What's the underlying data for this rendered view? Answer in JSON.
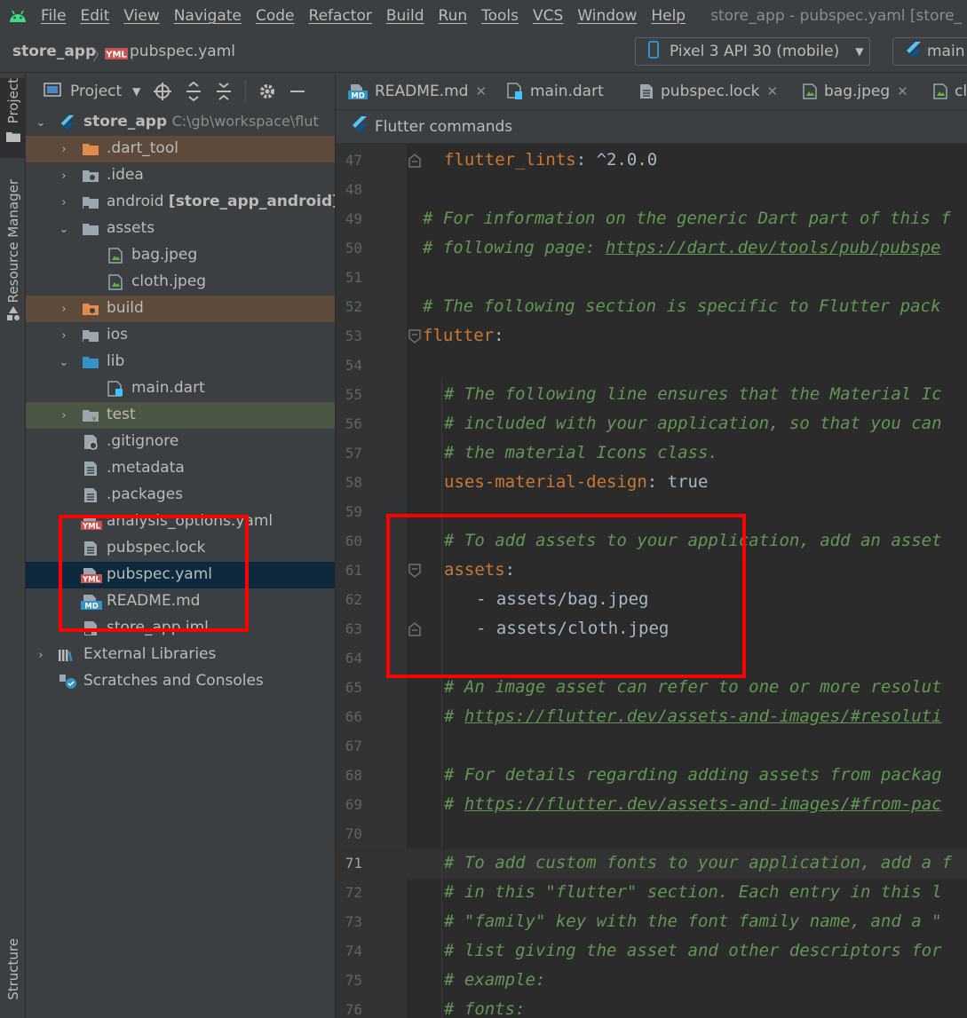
{
  "menubar": {
    "items": [
      "File",
      "Edit",
      "View",
      "Navigate",
      "Code",
      "Refactor",
      "Build",
      "Run",
      "Tools",
      "VCS",
      "Window",
      "Help"
    ],
    "window_title": "store_app - pubspec.yaml [store_"
  },
  "toolbar": {
    "project": "store_app",
    "file": "pubspec.yaml",
    "file_badge": "YML",
    "device": "Pixel 3 API 30 (mobile)",
    "run_config": "main"
  },
  "left_strip": {
    "project_tab": "Project",
    "resource_manager_tab": "Resource Manager",
    "structure_tab": "Structure"
  },
  "project_panel": {
    "title": "Project",
    "tree": [
      {
        "label": "store_app",
        "extra": "C:\\gb\\workspace\\flut",
        "expanded": true
      },
      {
        "label": ".dart_tool",
        "expanded": false
      },
      {
        "label": ".idea",
        "expanded": false
      },
      {
        "label": "android",
        "extra": "[store_app_android]",
        "expanded": false
      },
      {
        "label": "assets",
        "expanded": true
      },
      {
        "label": "bag.jpeg"
      },
      {
        "label": "cloth.jpeg"
      },
      {
        "label": "build",
        "expanded": false
      },
      {
        "label": "ios",
        "expanded": false
      },
      {
        "label": "lib",
        "expanded": true
      },
      {
        "label": "main.dart"
      },
      {
        "label": "test",
        "expanded": false
      },
      {
        "label": ".gitignore"
      },
      {
        "label": ".metadata"
      },
      {
        "label": ".packages"
      },
      {
        "label": "analysis_options.yaml"
      },
      {
        "label": "pubspec.lock"
      },
      {
        "label": "pubspec.yaml",
        "selected": true
      },
      {
        "label": "README.md"
      },
      {
        "label": "store_app.iml"
      },
      {
        "label": "External Libraries",
        "expanded": false
      },
      {
        "label": "Scratches and Consoles"
      }
    ]
  },
  "editor": {
    "tabs": [
      {
        "label": "README.md",
        "badge": "MD"
      },
      {
        "label": "main.dart"
      },
      {
        "label": "pubspec.lock"
      },
      {
        "label": "bag.jpeg"
      },
      {
        "label": "cl"
      }
    ],
    "flutter_commands": "Flutter commands",
    "lines": [
      {
        "n": "47",
        "text": "flutter_lints: ^2.0.0"
      },
      {
        "n": "48",
        "text": ""
      },
      {
        "n": "49",
        "text": "# For information on the generic Dart part of this f"
      },
      {
        "n": "50",
        "text": "# following page: ",
        "url": "https://dart.dev/tools/pub/pubspe"
      },
      {
        "n": "51",
        "text": ""
      },
      {
        "n": "52",
        "text": "# The following section is specific to Flutter pack"
      },
      {
        "n": "53",
        "text": "flutter:"
      },
      {
        "n": "54",
        "text": ""
      },
      {
        "n": "55",
        "text": "# The following line ensures that the Material Ic"
      },
      {
        "n": "56",
        "text": "# included with your application, so that you can"
      },
      {
        "n": "57",
        "text": "# the material Icons class."
      },
      {
        "n": "58",
        "text": "uses-material-design: true"
      },
      {
        "n": "59",
        "text": ""
      },
      {
        "n": "60",
        "text": "# To add assets to your application, add an asset"
      },
      {
        "n": "61",
        "text": "assets:"
      },
      {
        "n": "62",
        "text": "- assets/bag.jpeg"
      },
      {
        "n": "63",
        "text": "- assets/cloth.jpeg"
      },
      {
        "n": "64",
        "text": ""
      },
      {
        "n": "65",
        "text": "# An image asset can refer to one or more resolut"
      },
      {
        "n": "66",
        "text": "# ",
        "url": "https://flutter.dev/assets-and-images/#resoluti"
      },
      {
        "n": "67",
        "text": ""
      },
      {
        "n": "68",
        "text": "# For details regarding adding assets from packag"
      },
      {
        "n": "69",
        "text": "# ",
        "url": "https://flutter.dev/assets-and-images/#from-pac"
      },
      {
        "n": "70",
        "text": ""
      },
      {
        "n": "71",
        "text": "# To add custom fonts to your application, add a f",
        "active": true
      },
      {
        "n": "72",
        "text": "# in this \"flutter\" section. Each entry in this l"
      },
      {
        "n": "73",
        "text": "# \"family\" key with the font family name, and a \""
      },
      {
        "n": "74",
        "text": "# list giving the asset and other descriptors for"
      },
      {
        "n": "75",
        "text": "# example:"
      },
      {
        "n": "76",
        "text": "# fonts:"
      }
    ],
    "line_parts": {
      "flutter_lints_key": "flutter_lints",
      "flutter_lints_val": ": ^2.0.0",
      "flutter_key": "flutter",
      "uses_key": "uses-material-design",
      "uses_val": ": true",
      "assets_key": "assets",
      "colon": ":"
    }
  },
  "colors": {
    "highlight": "#ff0000",
    "comment": "#629755",
    "key": "#cc7832",
    "selection": "#0d293e"
  }
}
